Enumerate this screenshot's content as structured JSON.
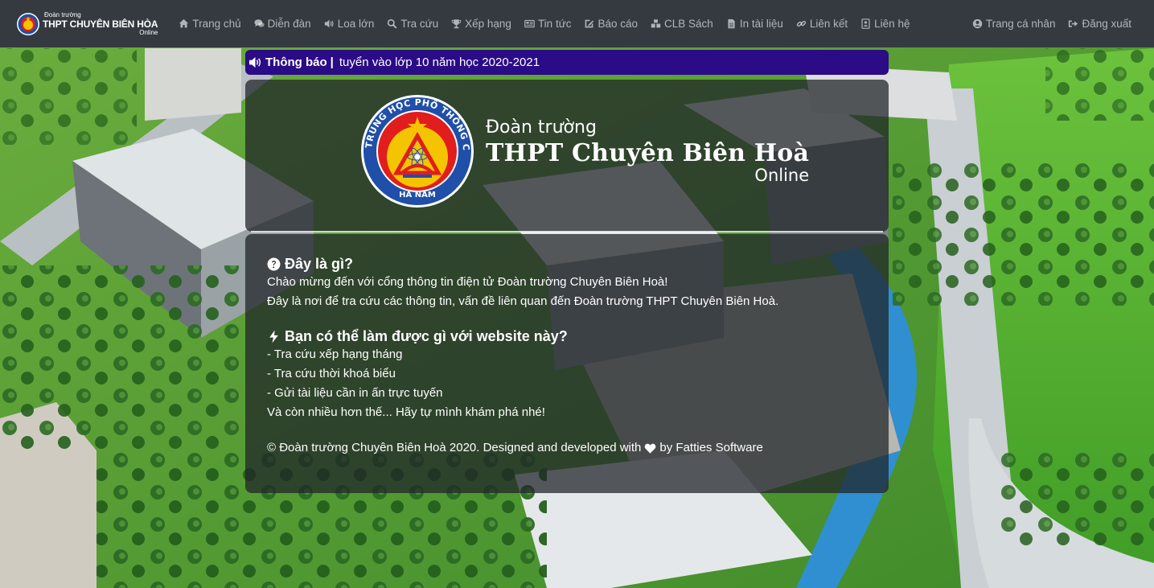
{
  "brand": {
    "top": "Đoàn trường",
    "main": "THPT CHUYÊN BIÊN HÒA",
    "sub": "Online"
  },
  "logo": {
    "ring_text": "TRUNG HỌC PHỔ THÔNG CHUYÊN BIÊN HÒA",
    "bottom_text": "HÀ NAM"
  },
  "nav": {
    "items": [
      {
        "label": "Trang chủ",
        "icon": "home-icon"
      },
      {
        "label": "Diễn đàn",
        "icon": "comments-icon"
      },
      {
        "label": "Loa lớn",
        "icon": "volume-icon"
      },
      {
        "label": "Tra cứu",
        "icon": "search-icon"
      },
      {
        "label": "Xếp hạng",
        "icon": "trophy-icon"
      },
      {
        "label": "Tin tức",
        "icon": "newspaper-icon"
      },
      {
        "label": "Báo cáo",
        "icon": "edit-icon"
      },
      {
        "label": "CLB Sách",
        "icon": "cubes-icon"
      },
      {
        "label": "In tài liệu",
        "icon": "file-icon"
      },
      {
        "label": "Liên kết",
        "icon": "link-icon"
      },
      {
        "label": "Liên hệ",
        "icon": "contact-card-icon"
      }
    ],
    "right": [
      {
        "label": "Trang cá nhân",
        "icon": "user-circle-icon"
      },
      {
        "label": "Đăng xuất",
        "icon": "sign-out-icon"
      }
    ]
  },
  "notice": {
    "title": "Thông báo",
    "separator": "|",
    "text": "tuyển vào lớp 10 năm học 2020-2021"
  },
  "hero": {
    "line1": "Đoàn trường",
    "line2": "THPT Chuyên Biên Hoà",
    "line3": "Online"
  },
  "info": {
    "q1_title": "Đây là gì?",
    "q1_lines": [
      "Chào mừng đến với cổng thông tin điện tử Đoàn trường Chuyên Biên Hoà!",
      "Đây là nơi để tra cứu các thông tin, vấn đề liên quan đến Đoàn trường THPT Chuyên Biên Hoà."
    ],
    "q2_title": "Bạn có thể làm được gì với website này?",
    "q2_lines": [
      "- Tra cứu xếp hạng tháng",
      "- Tra cứu thời khoá biểu",
      "- Gửi tài liệu cần in ấn trực tuyến",
      "Và còn nhiều hơn thế... Hãy tự mình khám phá nhé!"
    ],
    "footer_before": "© Đoàn trường Chuyên Biên Hoà 2020. Designed and developed with",
    "footer_after": "by Fatties Software"
  },
  "colors": {
    "navbar": "#343a40",
    "notice": "#2b0b86",
    "card": "rgba(33,37,41,0.74)",
    "logo_ring": "#1f4fa8",
    "logo_red": "#e21d1d",
    "logo_yellow": "#f5c400"
  }
}
